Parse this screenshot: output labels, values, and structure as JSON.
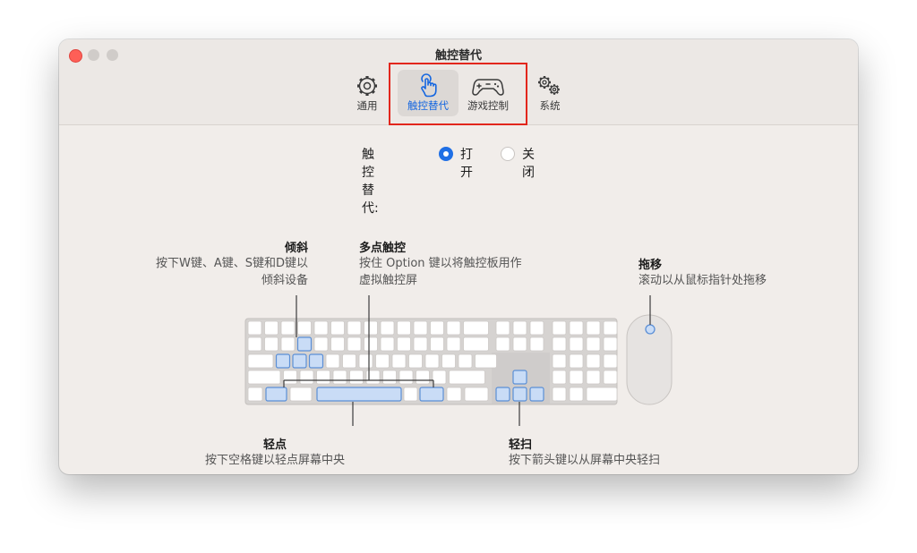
{
  "window": {
    "title": "触控替代",
    "tabs": [
      {
        "label": "通用",
        "icon": "gear-icon",
        "selected": false
      },
      {
        "label": "触控替代",
        "icon": "hand-pointer-icon",
        "selected": true
      },
      {
        "label": "游戏控制",
        "icon": "gamepad-icon",
        "selected": false
      },
      {
        "label": "系统",
        "icon": "gears-icon",
        "selected": false
      }
    ]
  },
  "touch_alt": {
    "label": "触控替代:",
    "options": [
      {
        "label": "打开",
        "checked": true
      },
      {
        "label": "关闭",
        "checked": false
      }
    ]
  },
  "callouts": {
    "tilt": {
      "title": "倾斜",
      "line1": "按下W键、A键、S键和D键以",
      "line2": "倾斜设备"
    },
    "multitouch": {
      "title": "多点触控",
      "line1": "按住 Option 键以将触控板用作",
      "line2": "虚拟触控屏"
    },
    "drag": {
      "title": "拖移",
      "line1": "滚动以从鼠标指针处拖移"
    },
    "tap": {
      "title": "轻点",
      "line1": "按下空格键以轻点屏幕中央"
    },
    "swipe": {
      "title": "轻扫",
      "line1": "按下箭头键以从屏幕中央轻扫"
    }
  },
  "colors": {
    "accent": "#1466e0",
    "highlight_key_fill": "#c9dcf6",
    "highlight_key_stroke": "#5b8fd6",
    "annotation_box": "#e2261c"
  }
}
